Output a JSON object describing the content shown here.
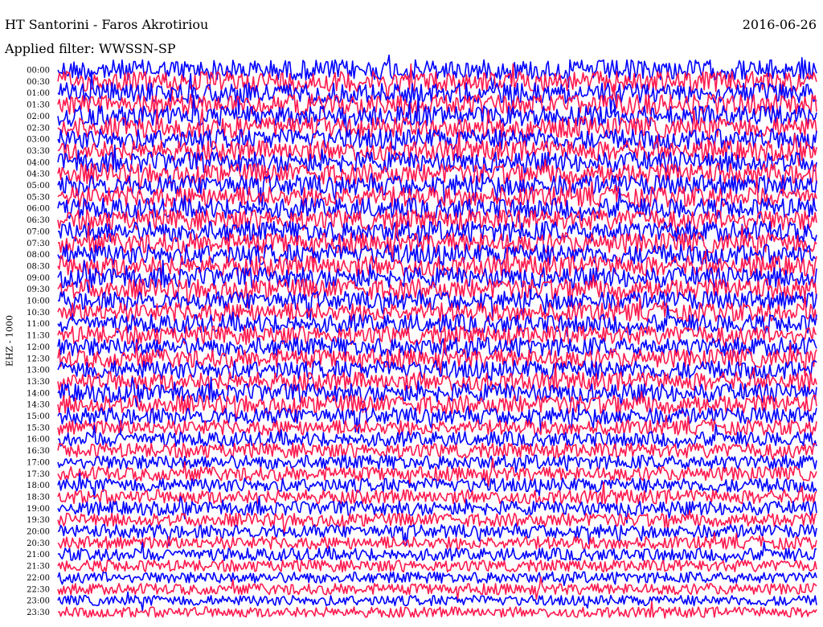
{
  "header": {
    "station": "HT Santorini - Faros Akrotiriou",
    "date": "2016-06-26",
    "filter": "Applied filter: WWSSN-SP"
  },
  "chart_data": {
    "type": "line",
    "title": "HT Santorini - Faros Akrotiriou",
    "date": "2016-06-26",
    "filter": "WWSSN-SP",
    "ylabel": "EHZ - 1000",
    "xlabel": "",
    "grid": false,
    "series_colors": [
      "#0000ff",
      "#ff1a4f"
    ],
    "rows": [
      {
        "time": "00:00",
        "amp": 0.55
      },
      {
        "time": "00:30",
        "amp": 0.55
      },
      {
        "time": "01:00",
        "amp": 0.55
      },
      {
        "time": "01:30",
        "amp": 0.55
      },
      {
        "time": "02:00",
        "amp": 0.55
      },
      {
        "time": "02:30",
        "amp": 0.55
      },
      {
        "time": "03:00",
        "amp": 0.55
      },
      {
        "time": "03:30",
        "amp": 0.55
      },
      {
        "time": "04:00",
        "amp": 0.55
      },
      {
        "time": "04:30",
        "amp": 0.55
      },
      {
        "time": "05:00",
        "amp": 0.55
      },
      {
        "time": "05:30",
        "amp": 0.55
      },
      {
        "time": "06:00",
        "amp": 0.55
      },
      {
        "time": "06:30",
        "amp": 0.55
      },
      {
        "time": "07:00",
        "amp": 0.55
      },
      {
        "time": "07:30",
        "amp": 0.55
      },
      {
        "time": "08:00",
        "amp": 0.55
      },
      {
        "time": "08:30",
        "amp": 0.55
      },
      {
        "time": "09:00",
        "amp": 0.55
      },
      {
        "time": "09:30",
        "amp": 0.55
      },
      {
        "time": "10:00",
        "amp": 0.5
      },
      {
        "time": "10:30",
        "amp": 0.5
      },
      {
        "time": "11:00",
        "amp": 0.5
      },
      {
        "time": "11:30",
        "amp": 0.5
      },
      {
        "time": "12:00",
        "amp": 0.5
      },
      {
        "time": "12:30",
        "amp": 0.5
      },
      {
        "time": "13:00",
        "amp": 0.5
      },
      {
        "time": "13:30",
        "amp": 0.5
      },
      {
        "time": "14:00",
        "amp": 0.5
      },
      {
        "time": "14:30",
        "amp": 0.5
      },
      {
        "time": "15:00",
        "amp": 0.45
      },
      {
        "time": "15:30",
        "amp": 0.4
      },
      {
        "time": "16:00",
        "amp": 0.4
      },
      {
        "time": "16:30",
        "amp": 0.4
      },
      {
        "time": "17:00",
        "amp": 0.38
      },
      {
        "time": "17:30",
        "amp": 0.38
      },
      {
        "time": "18:00",
        "amp": 0.38
      },
      {
        "time": "18:30",
        "amp": 0.38
      },
      {
        "time": "19:00",
        "amp": 0.38
      },
      {
        "time": "19:30",
        "amp": 0.36
      },
      {
        "time": "20:00",
        "amp": 0.36
      },
      {
        "time": "20:30",
        "amp": 0.34
      },
      {
        "time": "21:00",
        "amp": 0.34
      },
      {
        "time": "21:30",
        "amp": 0.32
      },
      {
        "time": "22:00",
        "amp": 0.3
      },
      {
        "time": "22:30",
        "amp": 0.3
      },
      {
        "time": "23:00",
        "amp": 0.28
      },
      {
        "time": "23:30",
        "amp": 0.28
      }
    ]
  }
}
